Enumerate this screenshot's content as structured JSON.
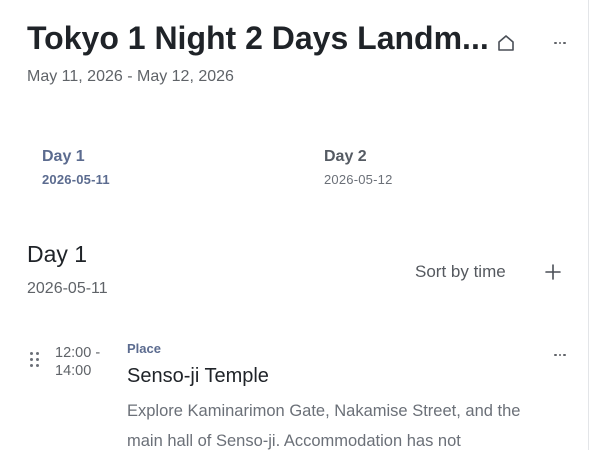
{
  "header": {
    "title": "Tokyo 1 Night 2 Days Landm...",
    "date_range": "May 11, 2026 - May 12, 2026",
    "home_icon": "home-icon",
    "more_icon": "more-horizontal-icon"
  },
  "day_tabs": [
    {
      "label": "Day 1",
      "date": "2026-05-11",
      "active": true
    },
    {
      "label": "Day 2",
      "date": "2026-05-12",
      "active": false
    }
  ],
  "section": {
    "title": "Day 1",
    "date": "2026-05-11",
    "sort_label": "Sort by time",
    "add_icon": "plus-icon"
  },
  "items": [
    {
      "time": "12:00 - 14:00",
      "category": "Place",
      "name": "Senso-ji Temple",
      "description": "Explore Kaminarimon Gate, Nakamise Street, and the main hall of Senso-ji. Accommodation has not"
    }
  ],
  "colors": {
    "accent": "#5b6b8f",
    "text": "#1f2328",
    "muted": "#6b7078"
  }
}
